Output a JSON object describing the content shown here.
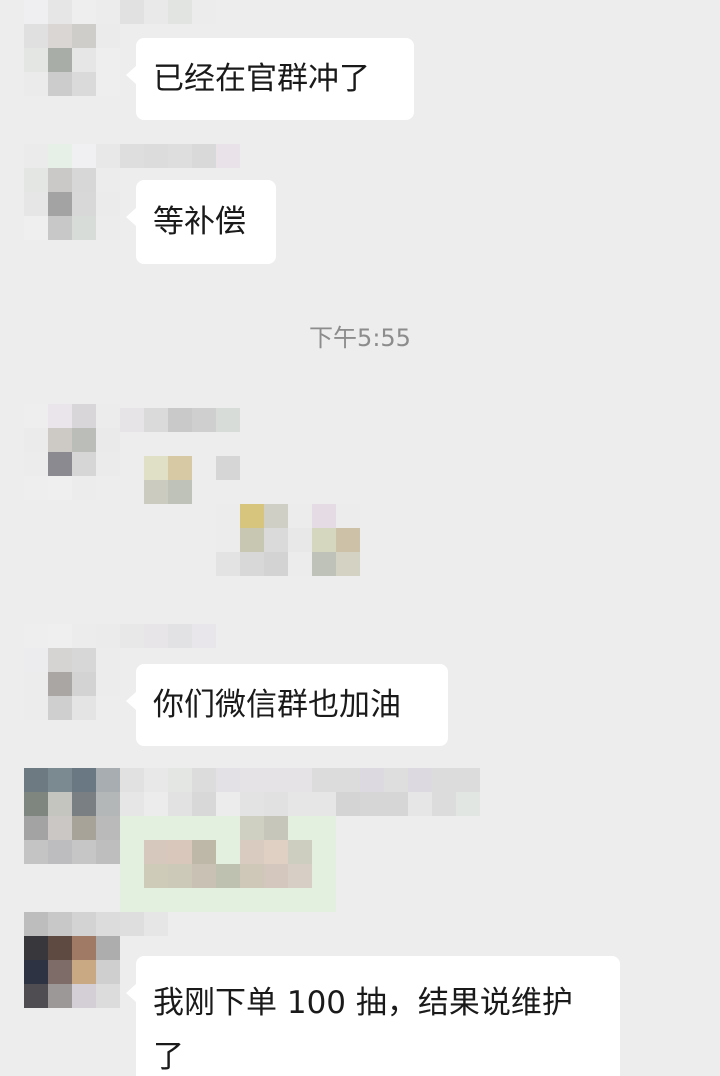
{
  "messages": [
    {
      "text": "已经在官群冲了"
    },
    {
      "text": "等补偿"
    },
    {
      "timestamp": "下午5:55"
    },
    {
      "text": "你们微信群也加油"
    },
    {
      "text": "我刚下单 100 抽，结果说维护了"
    }
  ],
  "colors": {
    "background": "#ededed",
    "bubble": "#ffffff",
    "text": "#1a1a1a",
    "timestamp": "#8c8c8c",
    "pixelated_sticker_bg": "#e3f0e0"
  },
  "obscured": [
    "avatar",
    "nickname",
    "sticker"
  ]
}
